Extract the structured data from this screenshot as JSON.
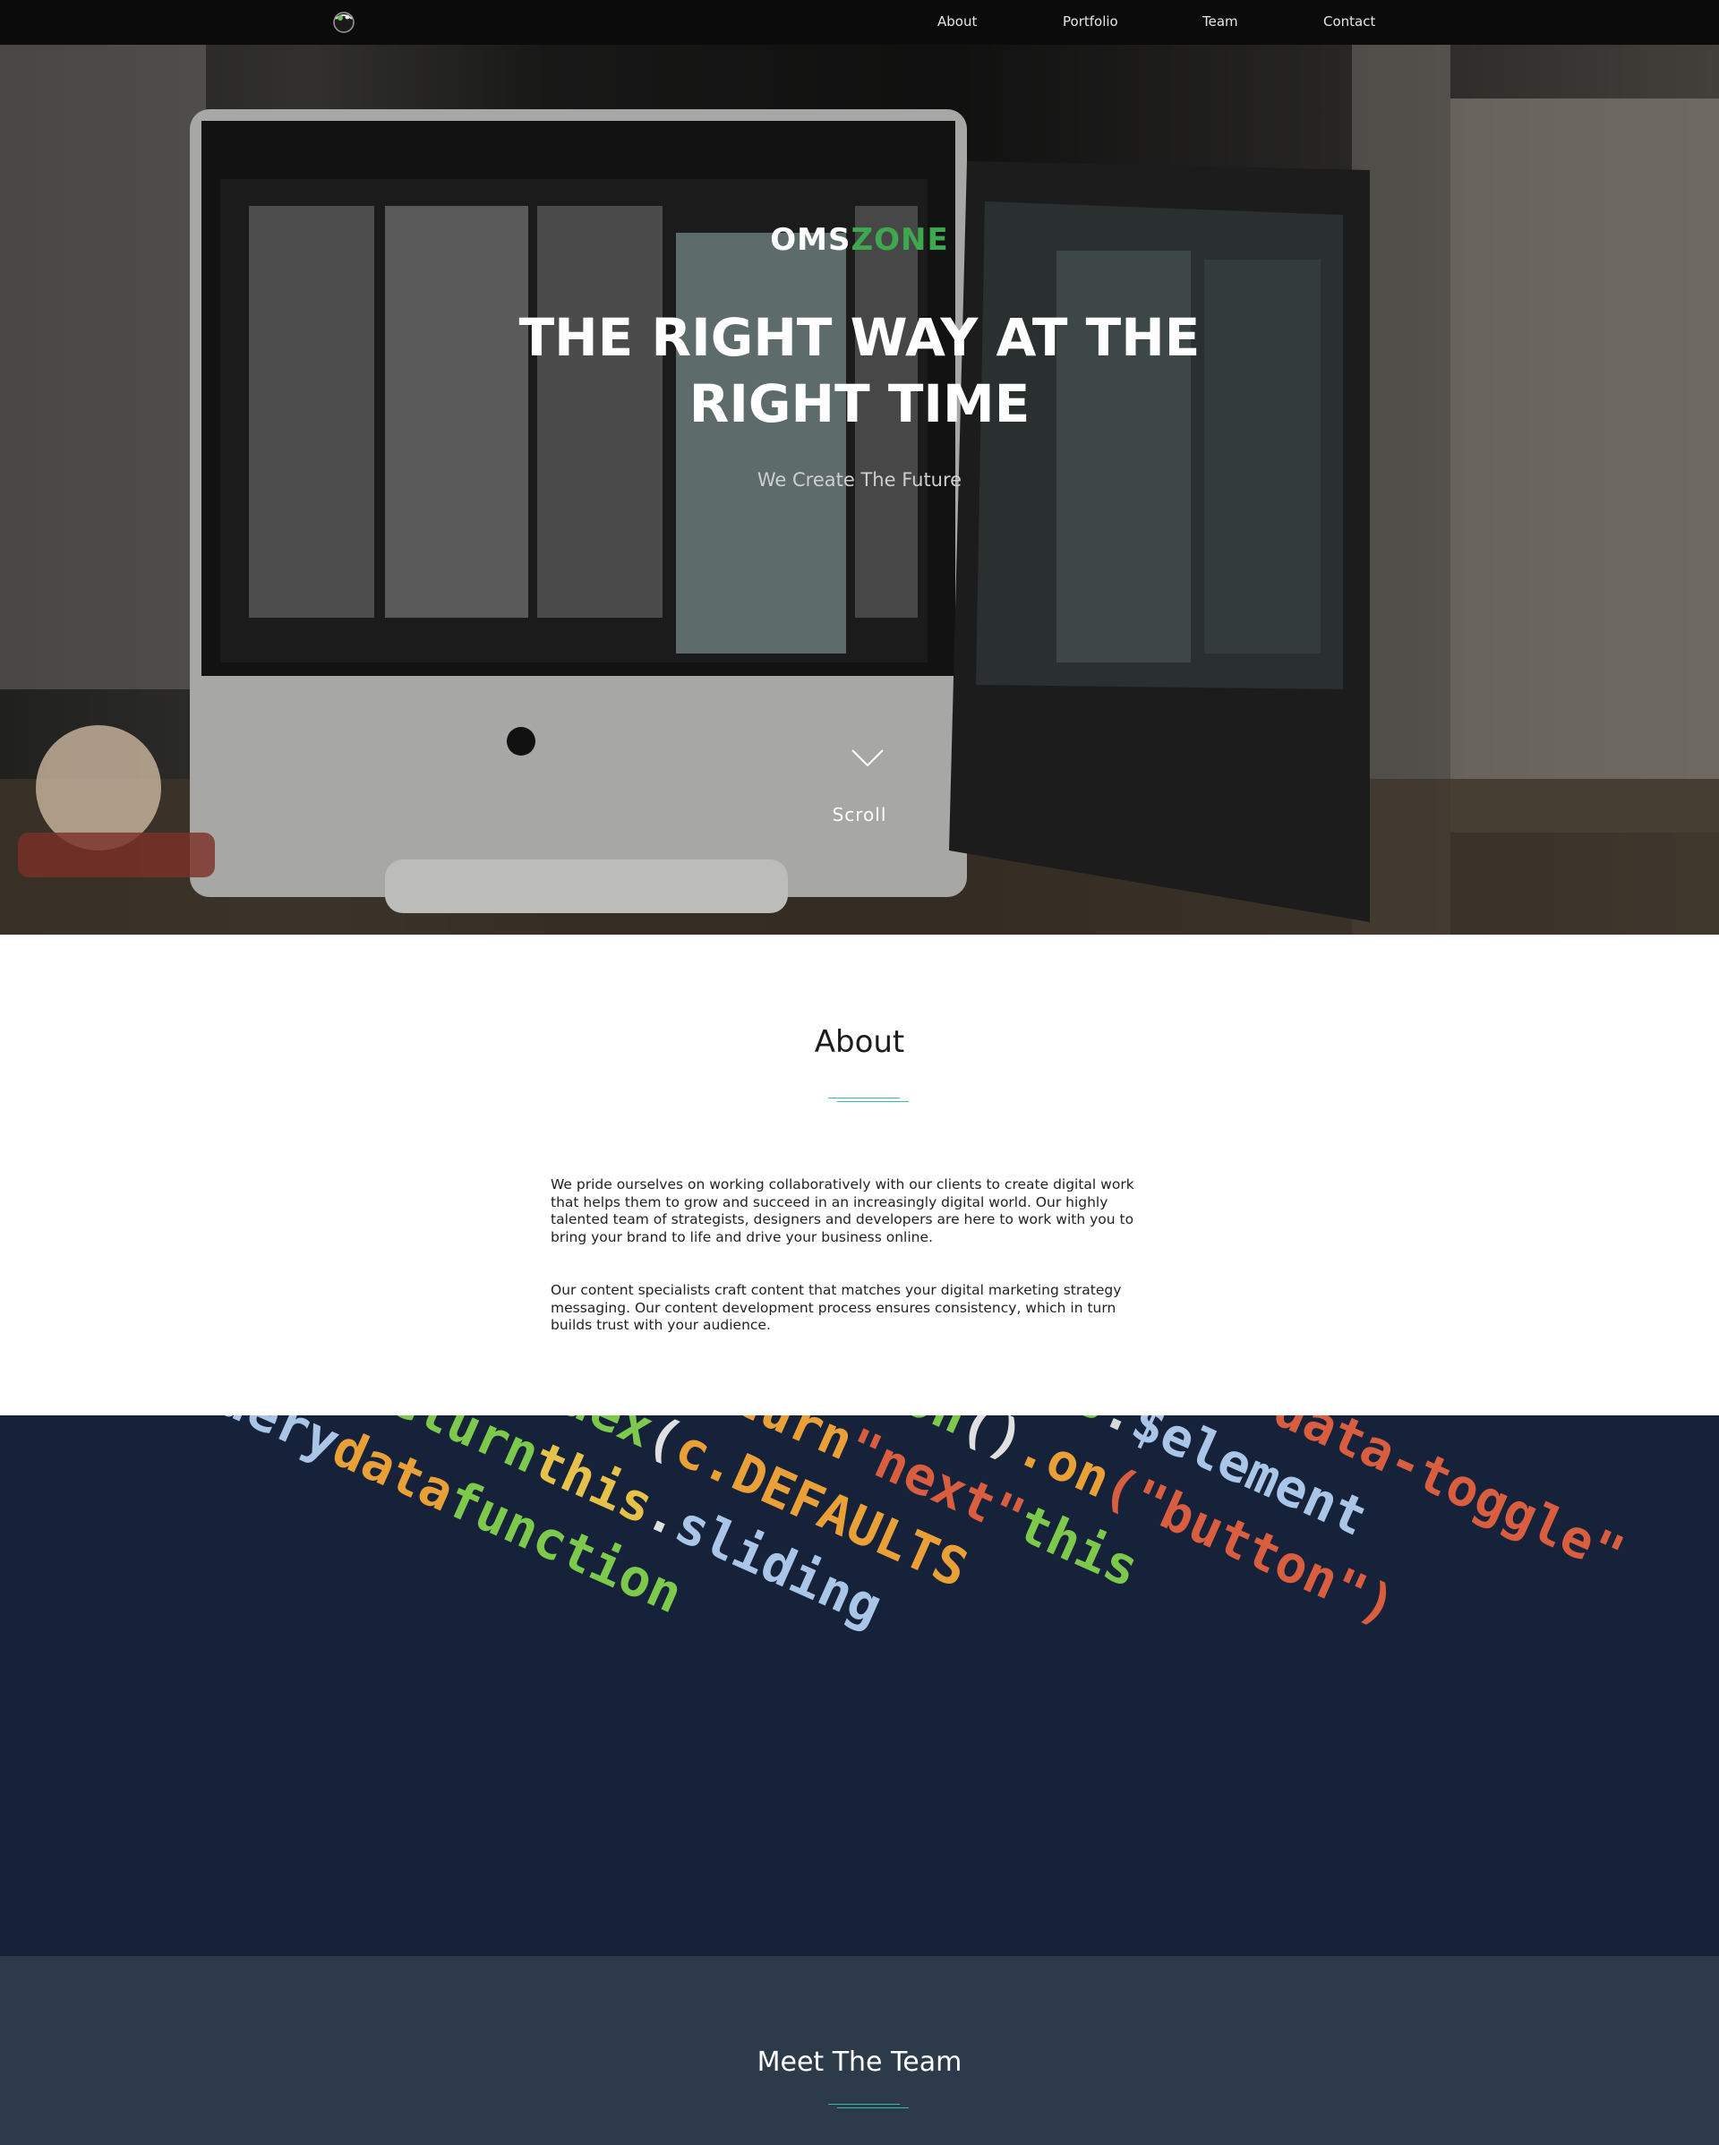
{
  "nav": {
    "logo_icon": "planet-logo-icon",
    "links": [
      "About",
      "Portfolio",
      "Team",
      "Contact"
    ]
  },
  "hero": {
    "brand_white": "OMS",
    "brand_green": "ZONE",
    "headline": "THE RIGHT WAY AT THE RIGHT TIME",
    "tagline": "We Create The Future",
    "scroll_label": "Scroll",
    "scroll_icon": "chevron-down-icon"
  },
  "about": {
    "title": "About",
    "paragraphs": [
      "We pride ourselves on working collaboratively with our clients to create digital work that helps them to grow and succeed in an increasingly digital world. Our highly talented team of strategists, designers and developers are here to work with you to bring your brand to life and drive your business online.",
      "Our content specialists craft content that matches your digital marketing strategy messaging. Our content development process ensures consistency, which in turn builds trust with your audience."
    ]
  },
  "team": {
    "title": "Meet The Team"
  },
  "colors": {
    "nav_bg": "#0b0b0b",
    "brand_green": "#3ea84f",
    "divider_teal": "#3bb8a8",
    "team_bg": "#2c3a4a"
  }
}
